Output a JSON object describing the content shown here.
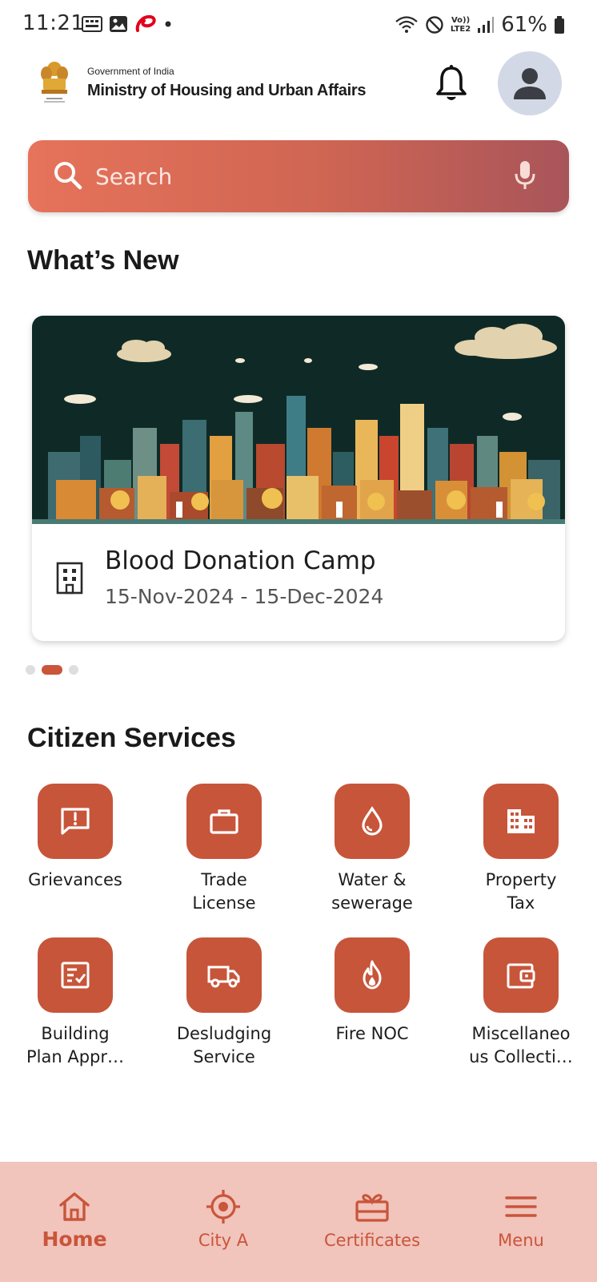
{
  "status_bar": {
    "time": "11:21",
    "battery_percent": "61%",
    "network_label_top": "Vo))",
    "network_label_bottom": "LTE2"
  },
  "header": {
    "gov_label": "Government of India",
    "ministry_name": "Ministry of Housing and Urban Affairs"
  },
  "search": {
    "placeholder": "Search"
  },
  "whats_new": {
    "title": "What’s New",
    "card": {
      "title": "Blood Donation Camp",
      "dates": "15-Nov-2024 - 15-Dec-2024"
    },
    "carousel_page_count": 3,
    "carousel_active_index": 1
  },
  "citizen_services": {
    "title": "Citizen Services",
    "items": [
      {
        "label_line1": "Grievances",
        "label_line2": "",
        "icon": "grievance-icon"
      },
      {
        "label_line1": "Trade",
        "label_line2": "License",
        "icon": "briefcase-icon"
      },
      {
        "label_line1": "Water &",
        "label_line2": "sewerage",
        "icon": "water-drop-icon"
      },
      {
        "label_line1": "Property",
        "label_line2": "Tax",
        "icon": "building-icon"
      },
      {
        "label_line1": "Building",
        "label_line2": "Plan Appr…",
        "icon": "checklist-icon"
      },
      {
        "label_line1": "Desludging",
        "label_line2": "Service",
        "icon": "truck-icon"
      },
      {
        "label_line1": "Fire NOC",
        "label_line2": "",
        "icon": "fire-icon"
      },
      {
        "label_line1": "Miscellaneo",
        "label_line2": "us Collecti…",
        "icon": "wallet-icon"
      }
    ]
  },
  "bottom_nav": {
    "items": [
      {
        "label": "Home",
        "icon": "home-icon",
        "active": true
      },
      {
        "label": "City A",
        "icon": "location-target-icon",
        "active": false
      },
      {
        "label": "Certificates",
        "icon": "certificate-icon",
        "active": false
      },
      {
        "label": "Menu",
        "icon": "menu-icon",
        "active": false
      }
    ]
  },
  "colors": {
    "accent": "#c7553a",
    "nav_background": "#f1c4bc",
    "search_gradient_start": "#e6735a",
    "search_gradient_end": "#a8555a",
    "avatar_background": "#d3d8e6"
  }
}
